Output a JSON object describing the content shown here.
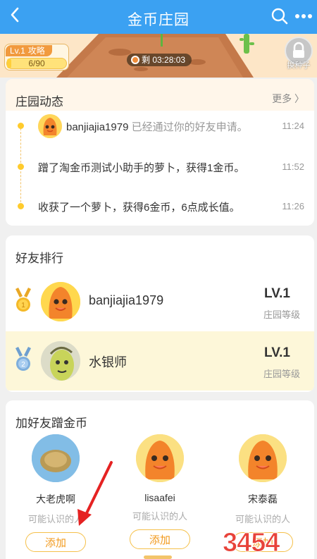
{
  "header": {
    "title": "金币庄园"
  },
  "farm": {
    "level_tag": "Lv.1",
    "level_tag_suffix": "攻略",
    "progress_text": "6/90",
    "progress_fraction": 0.0667,
    "timer": "剩 03:28:03",
    "seed_label": "换种子"
  },
  "news": {
    "title": "庄园动态",
    "more": "更多 〉",
    "items": [
      {
        "user": "banjiajia1979",
        "text": " 已经通过你的好友申请。",
        "time": "11:24"
      },
      {
        "text": "蹭了淘金币测试小助手的萝卜，获得1金币。",
        "time": "11:52"
      },
      {
        "text": "收获了一个萝卜，获得6金币，6点成长值。",
        "time": "11:26"
      }
    ]
  },
  "ranking": {
    "title": "好友排行",
    "rows": [
      {
        "rank": "1",
        "name": "banjiajia1979",
        "level": "LV.1",
        "level_label": "庄园等级"
      },
      {
        "rank": "2",
        "name": "水银师",
        "level": "LV.1",
        "level_label": "庄园等级"
      }
    ]
  },
  "add_friends": {
    "title": "加好友蹭金币",
    "people": [
      {
        "name": "大老虎啊",
        "sub": "可能认识的人",
        "button": "添加"
      },
      {
        "name": "lisaafei",
        "sub": "可能认识的人",
        "button": "添加"
      },
      {
        "name": "宋泰磊",
        "sub": "可能认识的人",
        "button": "添加"
      }
    ]
  },
  "watermark": "3454",
  "colors": {
    "header": "#3ba1f2",
    "accent": "#f29a1d",
    "highlight_row": "#fdf7d9",
    "arrow": "#e52222"
  }
}
